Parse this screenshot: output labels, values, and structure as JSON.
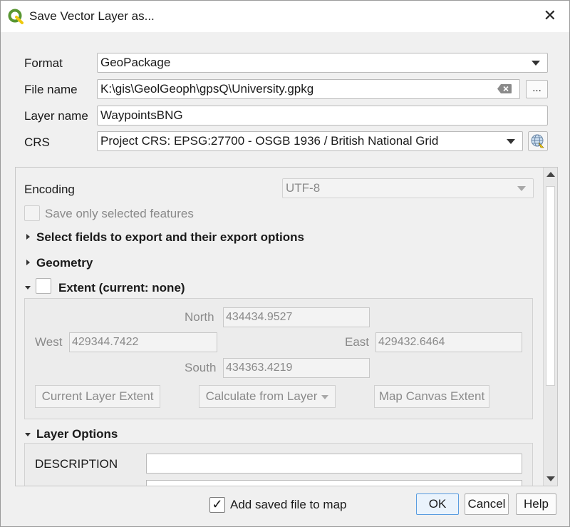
{
  "window": {
    "title": "Save Vector Layer as...",
    "close_symbol": "✕",
    "icon": "qgis-logo-icon"
  },
  "form": {
    "format_label": "Format",
    "format_value": "GeoPackage",
    "filename_label": "File name",
    "filename_value": "K:\\gis\\GeolGeoph\\gpsQ\\University.gpkg",
    "browse_label": "...",
    "layername_label": "Layer name",
    "layername_value": "WaypointsBNG",
    "crs_label": "CRS",
    "crs_value": "Project CRS: EPSG:27700 - OSGB 1936 / British National Grid"
  },
  "options": {
    "encoding_label": "Encoding",
    "encoding_value": "UTF-8",
    "save_selected_label": "Save only selected features",
    "fields_section": "Select fields to export and their export options",
    "geometry_section": "Geometry",
    "extent_section": "Extent (current: none)",
    "layer_options_section": "Layer Options"
  },
  "extent": {
    "north_label": "North",
    "north_value": "434434.9527",
    "west_label": "West",
    "west_value": "429344.7422",
    "east_label": "East",
    "east_value": "429432.6464",
    "south_label": "South",
    "south_value": "434363.4219",
    "current_layer_btn": "Current Layer Extent",
    "calculate_btn": "Calculate from Layer",
    "map_canvas_btn": "Map Canvas Extent"
  },
  "layer_options": {
    "description_label": "DESCRIPTION",
    "description_value": ""
  },
  "footer": {
    "add_to_map_label": "Add saved file to map",
    "add_to_map_checked": true,
    "check_mark": "✓",
    "ok": "OK",
    "cancel": "Cancel",
    "help": "Help"
  },
  "colors": {
    "default_button_border": "#5a9de0",
    "qgis_green": "#589632",
    "qgis_yellow": "#eec90d"
  }
}
